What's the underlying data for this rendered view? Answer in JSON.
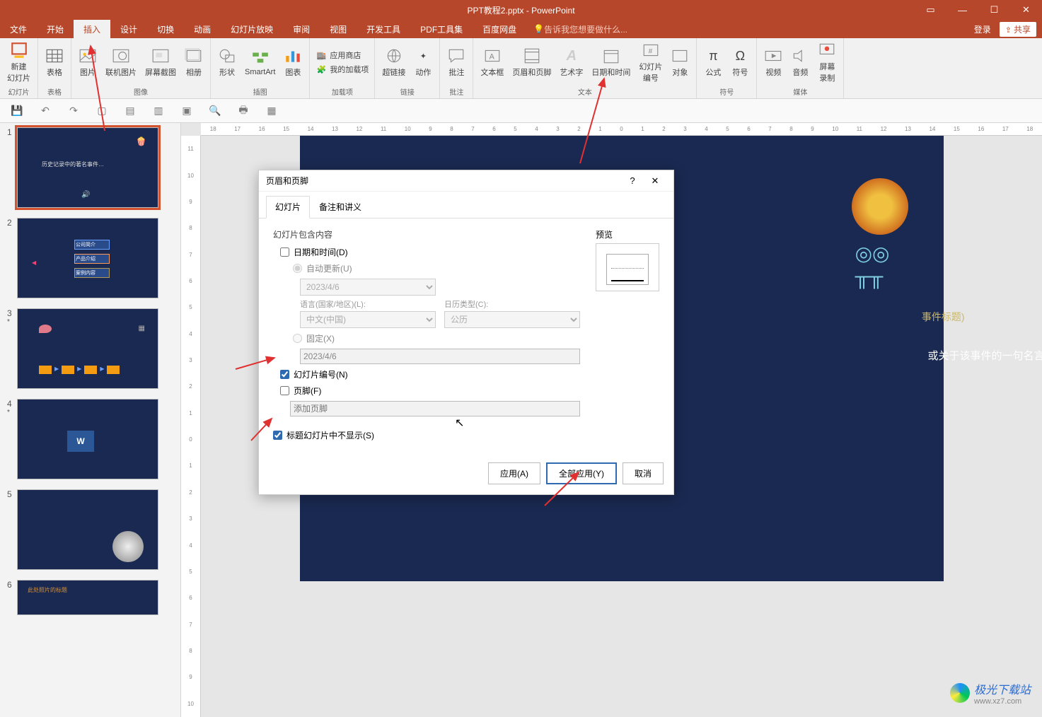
{
  "window": {
    "title": "PPT教程2.pptx - PowerPoint"
  },
  "menu_tabs": [
    "文件",
    "开始",
    "插入",
    "设计",
    "切换",
    "动画",
    "幻灯片放映",
    "审阅",
    "视图",
    "开发工具",
    "PDF工具集",
    "百度网盘"
  ],
  "active_tab_index": 2,
  "tell_me_placeholder": "告诉我您想要做什么...",
  "login_label": "登录",
  "share_label": "共享",
  "ribbon_groups": {
    "slides": {
      "label": "幻灯片",
      "items": [
        "新建\n幻灯片"
      ]
    },
    "tables": {
      "label": "表格",
      "items": [
        "表格"
      ]
    },
    "images": {
      "label": "图像",
      "items": [
        "图片",
        "联机图片",
        "屏幕截图",
        "相册"
      ]
    },
    "illus": {
      "label": "插图",
      "items": [
        "形状",
        "SmartArt",
        "图表"
      ]
    },
    "addins": {
      "label": "加载项",
      "items": [
        "应用商店",
        "我的加载项"
      ]
    },
    "links": {
      "label": "链接",
      "items": [
        "超链接",
        "动作"
      ]
    },
    "comments": {
      "label": "批注",
      "items": [
        "批注"
      ]
    },
    "text": {
      "label": "文本",
      "items": [
        "文本框",
        "页眉和页脚",
        "艺术字",
        "日期和时间",
        "幻灯片\n编号",
        "对象"
      ]
    },
    "symbols": {
      "label": "符号",
      "items": [
        "公式",
        "符号"
      ]
    },
    "media": {
      "label": "媒体",
      "items": [
        "视频",
        "音频",
        "屏幕\n录制"
      ]
    }
  },
  "quickaccess": [
    "save",
    "undo",
    "redo",
    "from-beginning",
    "touch",
    "table",
    "start",
    "zoom",
    "print",
    "fx"
  ],
  "ruler_h": [
    "18",
    "17",
    "16",
    "15",
    "14",
    "13",
    "12",
    "11",
    "10",
    "9",
    "8",
    "7",
    "6",
    "5",
    "4",
    "3",
    "2",
    "1",
    "0",
    "1",
    "2",
    "3",
    "4",
    "5",
    "6",
    "7",
    "8",
    "9",
    "10",
    "11",
    "12",
    "13",
    "14",
    "15",
    "16",
    "17",
    "18"
  ],
  "ruler_v": [
    "11",
    "10",
    "9",
    "8",
    "7",
    "6",
    "5",
    "4",
    "3",
    "2",
    "1",
    "0",
    "1",
    "2",
    "3",
    "4",
    "5",
    "6",
    "7",
    "8",
    "9",
    "10"
  ],
  "thumbs": [
    {
      "num": "1",
      "star": false,
      "title": "历史记录中的著名事件…"
    },
    {
      "num": "2",
      "star": false,
      "labels": [
        "公司简介",
        "产品介绍",
        "案例内容"
      ]
    },
    {
      "num": "3",
      "star": true
    },
    {
      "num": "4",
      "star": true
    },
    {
      "num": "5",
      "star": false
    },
    {
      "num": "6",
      "star": false,
      "title": "此处照片的标题"
    }
  ],
  "slide": {
    "caption1": "事件标题)",
    "caption2": "或关于该事件的一句名言。"
  },
  "dialog": {
    "title": "页眉和页脚",
    "tabs": [
      "幻灯片",
      "备注和讲义"
    ],
    "active_tab": 0,
    "section_title": "幻灯片包含内容",
    "datetime_label": "日期和时间(D)",
    "datetime_checked": false,
    "auto_label": "自动更新(U)",
    "auto_checked": true,
    "date_value": "2023/4/6",
    "lang_label": "语言(国家/地区)(L):",
    "lang_value": "中文(中国)",
    "caltype_label": "日历类型(C):",
    "caltype_value": "公历",
    "fixed_label": "固定(X)",
    "fixed_checked": false,
    "fixed_value": "2023/4/6",
    "slidenum_label": "幻灯片编号(N)",
    "slidenum_checked": true,
    "footer_label": "页脚(F)",
    "footer_checked": false,
    "footer_placeholder": "添加页脚",
    "hide_on_title_label": "标题幻灯片中不显示(S)",
    "hide_on_title_checked": true,
    "preview_label": "预览",
    "btn_apply": "应用(A)",
    "btn_apply_all": "全部应用(Y)",
    "btn_cancel": "取消"
  },
  "watermark": {
    "name": "极光下载站",
    "url": "www.xz7.com"
  }
}
